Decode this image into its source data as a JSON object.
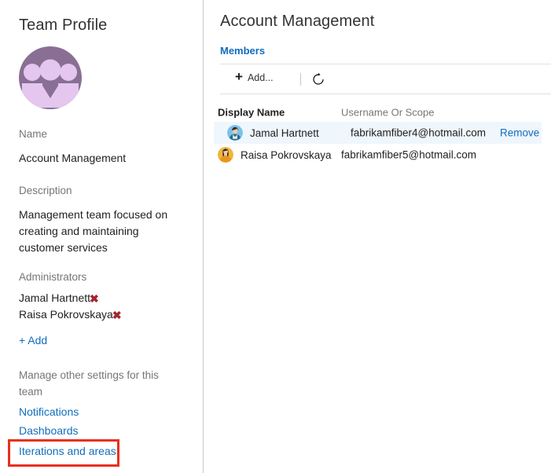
{
  "sidebar": {
    "title": "Team Profile",
    "avatar_icon": "team-group-avatar",
    "avatar_color": "#8a6f94",
    "name_label": "Name",
    "name_value": "Account Management",
    "description_label": "Description",
    "description_value": "Management team focused on creating and maintaining customer services",
    "administrators_label": "Administrators",
    "administrators": [
      {
        "name": "Jamal Hartnett",
        "remove_icon": "remove-x-icon"
      },
      {
        "name": "Raisa Pokrovskaya",
        "remove_icon": "remove-x-icon"
      }
    ],
    "add_admin_label": "+ Add",
    "manage_note": "Manage other settings for this team",
    "links": [
      {
        "label": "Notifications"
      },
      {
        "label": "Dashboards"
      },
      {
        "label": "Iterations and areas"
      }
    ],
    "highlight_color": "#e8301c",
    "link_color": "#106ebe",
    "remove_icon_color": "#a4262c"
  },
  "main": {
    "title": "Account Management",
    "tab_label": "Members",
    "toolbar": {
      "add_label": "Add...",
      "add_icon": "plus-icon",
      "refresh_icon": "refresh-icon"
    },
    "table": {
      "columns": [
        "Display Name",
        "Username Or Scope",
        ""
      ],
      "rows": [
        {
          "avatar_icon": "person-avatar-blue",
          "display_name": "Jamal Hartnett",
          "username": "fabrikamfiber4@hotmail.com",
          "action": "Remove",
          "highlighted": true
        },
        {
          "avatar_icon": "person-avatar-orange",
          "display_name": "Raisa Pokrovskaya",
          "username": "fabrikamfiber5@hotmail.com",
          "action": "",
          "highlighted": false
        }
      ]
    }
  }
}
